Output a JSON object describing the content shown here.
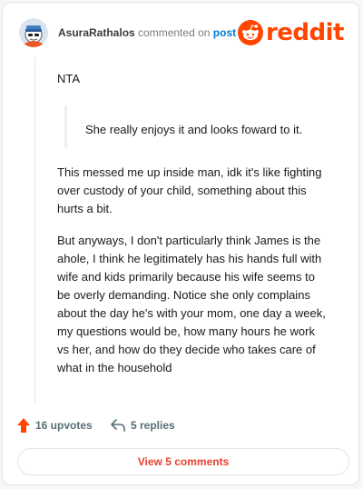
{
  "header": {
    "username": "AsuraRathalos",
    "action": "commented on",
    "post_link": "post",
    "logo_text": "reddit",
    "avatar_icon": "snoo-avatar-icon"
  },
  "comment": {
    "line1": "NTA",
    "quote": "She really enjoys it and looks foward to it.",
    "paragraphs": [
      "This messed me up inside man, idk it's like fighting over custody of your child, something about this hurts a bit.",
      "But anyways, I don't particularly think James is the ahole, I think he legitimately has his hands full with wife and kids primarily because his wife seems to be overly demanding. Notice she only complains about the day he's with your mom, one day a week, my questions would be, how many hours he work vs her, and how do they decide who takes care of what in the household"
    ]
  },
  "footer": {
    "upvotes": "16 upvotes",
    "replies": "5 replies",
    "upvote_icon": "upvote-arrow-icon",
    "reply_icon": "reply-arrow-icon",
    "view_comments": "View 5 comments"
  },
  "colors": {
    "brand": "#ff4500",
    "link": "#0079d3",
    "button_text": "#e8412c"
  }
}
